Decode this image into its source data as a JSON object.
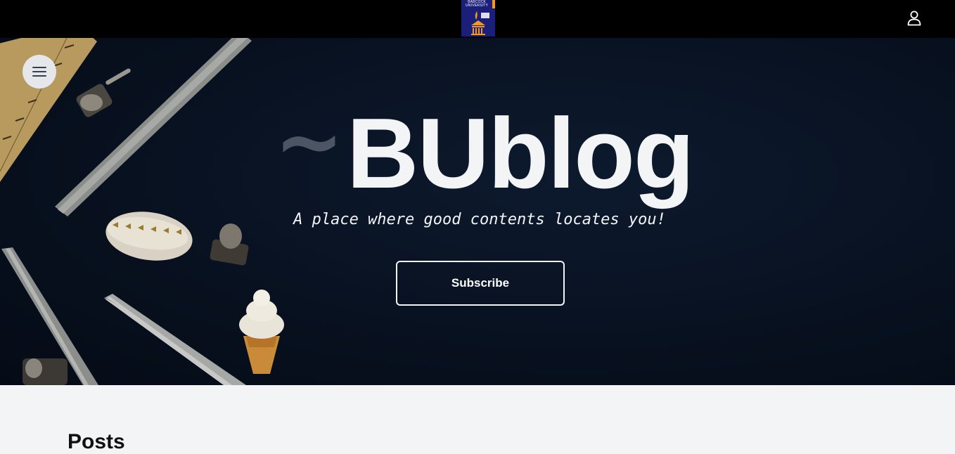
{
  "header": {
    "logo_text": "BABCOCK UNIVERSITY",
    "logo_icon": "babcock-university-logo",
    "user_icon": "user-icon"
  },
  "hero": {
    "menu_icon": "menu-icon",
    "brand_prefix": "~",
    "brand_name": "BUblog",
    "tagline": "A place where good contents locates you!",
    "subscribe_label": "Subscribe"
  },
  "main": {
    "posts_title": "Posts"
  },
  "colors": {
    "topbar": "#000000",
    "hero_bg": "#081120",
    "brand_text": "#f3f4f6",
    "tilde": "#4b5563",
    "page_bg": "#f3f4f6",
    "logo_bg": "#1b1f7a",
    "logo_accent": "#f29a1d"
  }
}
